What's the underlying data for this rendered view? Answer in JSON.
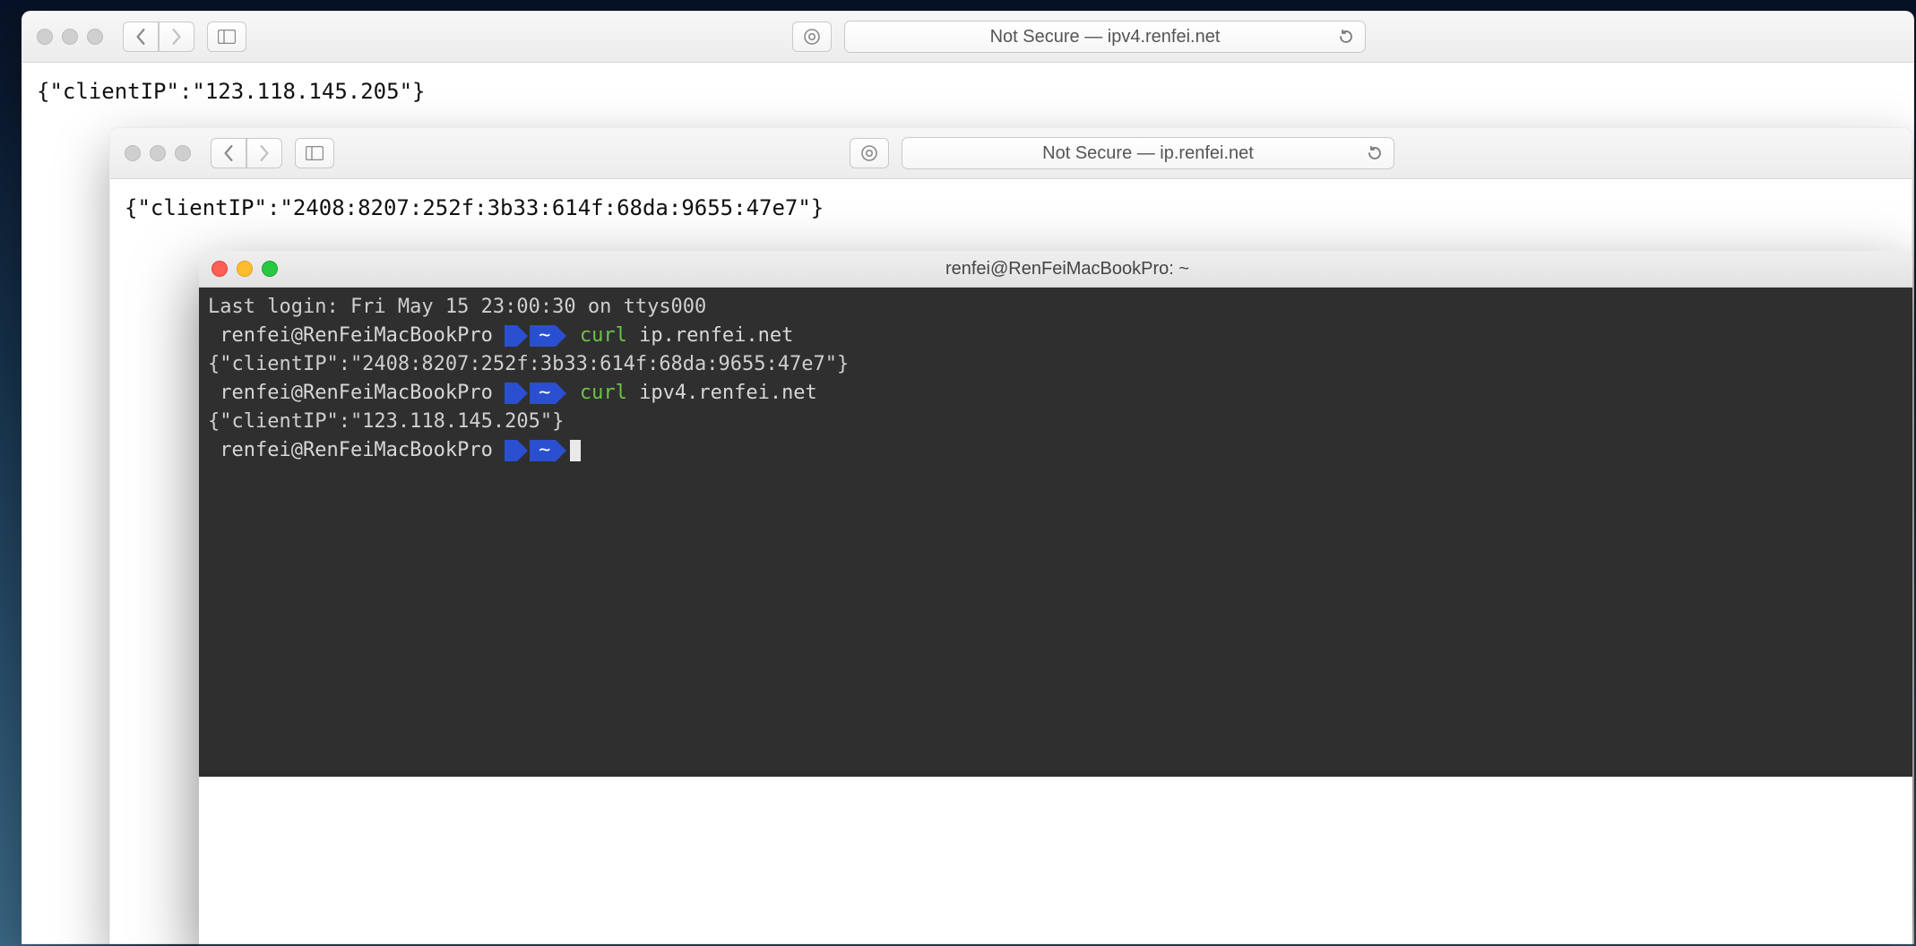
{
  "safari1": {
    "address_text": "Not Secure — ipv4.renfei.net",
    "body": "{\"clientIP\":\"123.118.145.205\"}"
  },
  "safari2": {
    "address_text": "Not Secure — ip.renfei.net",
    "body": "{\"clientIP\":\"2408:8207:252f:3b33:614f:68da:9655:47e7\"}"
  },
  "terminal": {
    "title": "renfei@RenFeiMacBookPro: ~",
    "last_login": "Last login: Fri May 15 23:00:30 on ttys000",
    "userhost": "renfei@RenFeiMacBookPro",
    "home_marker": "~",
    "cmd_keyword": "curl",
    "cmd1_arg": "ip.renfei.net",
    "out1": "{\"clientIP\":\"2408:8207:252f:3b33:614f:68da:9655:47e7\"}",
    "cmd2_arg": "ipv4.renfei.net",
    "out2": "{\"clientIP\":\"123.118.145.205\"}"
  }
}
